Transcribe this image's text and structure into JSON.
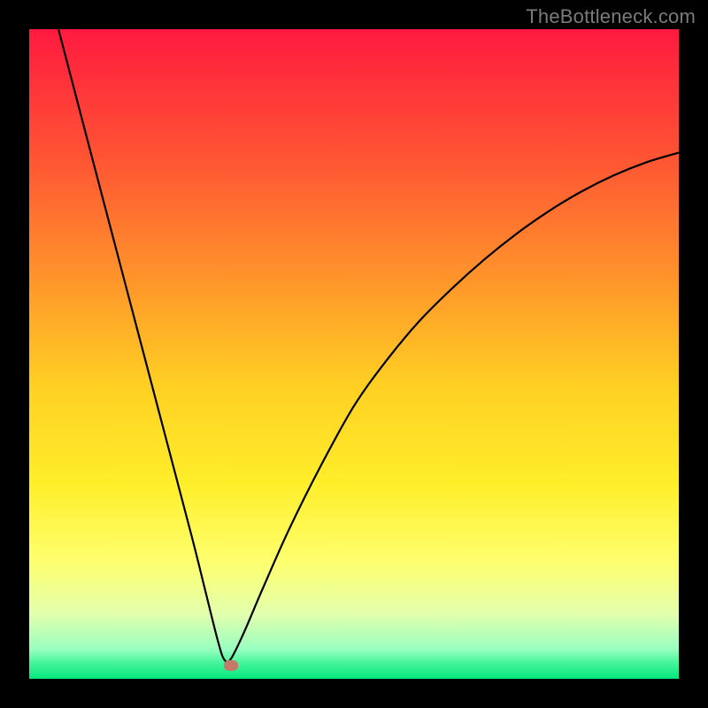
{
  "watermark": {
    "text": "TheBottleneck.com"
  },
  "chart_data": {
    "type": "line",
    "title": "",
    "xlabel": "",
    "ylabel": "",
    "xlim": [
      0,
      100
    ],
    "ylim": [
      0,
      100
    ],
    "grid": false,
    "legend": false,
    "background_gradient": {
      "stops": [
        {
          "pos": 0.0,
          "color": "#ff1a3f"
        },
        {
          "pos": 0.2,
          "color": "#ff5534"
        },
        {
          "pos": 0.4,
          "color": "#ff9a2a"
        },
        {
          "pos": 0.55,
          "color": "#ffd023"
        },
        {
          "pos": 0.7,
          "color": "#ffee2a"
        },
        {
          "pos": 0.82,
          "color": "#fdff6e"
        },
        {
          "pos": 0.9,
          "color": "#e3ffad"
        },
        {
          "pos": 0.955,
          "color": "#98ffc0"
        },
        {
          "pos": 0.975,
          "color": "#47f59b"
        },
        {
          "pos": 1.0,
          "color": "#06e77e"
        }
      ]
    },
    "series": [
      {
        "name": "bottleneck-curve",
        "color": "#000000",
        "x": [
          4.5,
          10,
          15,
          20,
          25,
          27,
          29,
          30,
          31,
          33,
          36,
          40,
          45,
          50,
          55,
          60,
          65,
          70,
          75,
          80,
          85,
          90,
          95,
          100
        ],
        "y": [
          100,
          79,
          60,
          41,
          22,
          14,
          6,
          3,
          3,
          7,
          14,
          23,
          33,
          42,
          49,
          55,
          60,
          64.5,
          68.5,
          72,
          75,
          77.5,
          79.5,
          81
        ]
      }
    ],
    "marker": {
      "x": 31,
      "y": 2,
      "color": "#c47a6a"
    }
  }
}
